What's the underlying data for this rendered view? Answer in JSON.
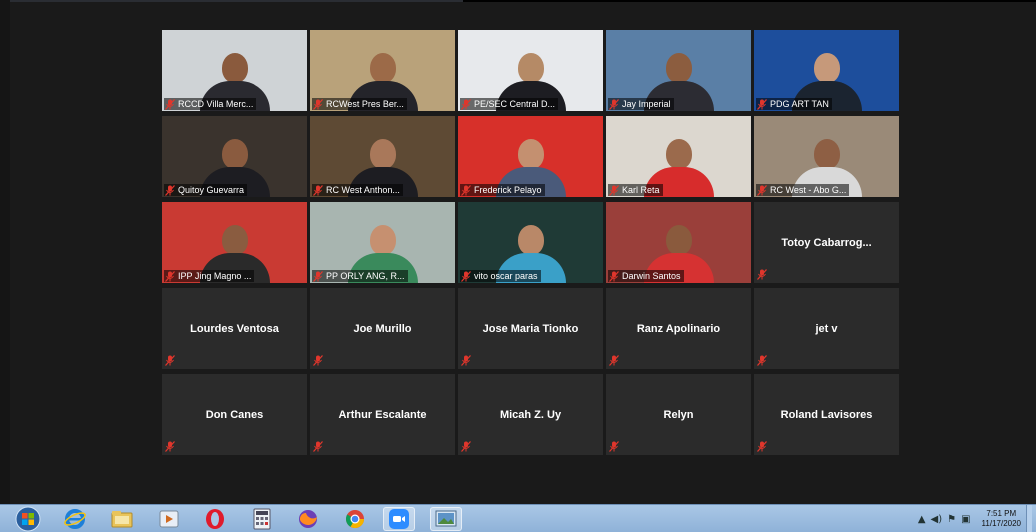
{
  "participants": [
    {
      "name": "RCCD Villa Merc...",
      "video": true,
      "bg": "#cfd3d6",
      "skin": "#8a5a3d",
      "shirt": "#2a2a30"
    },
    {
      "name": "RCWest Pres Ber...",
      "video": true,
      "bg": "#b9a27a",
      "skin": "#9c6a48",
      "shirt": "#24242a"
    },
    {
      "name": "PE/SEC Central D...",
      "video": true,
      "bg": "#e7e9ec",
      "skin": "#b58a66",
      "shirt": "#1d1d22"
    },
    {
      "name": "Jay Imperial",
      "video": true,
      "bg": "#5a7fa6",
      "skin": "#8c5d3f",
      "shirt": "#2c2c33"
    },
    {
      "name": "PDG ART TAN",
      "video": true,
      "bg": "#1d4e9c",
      "skin": "#c6997a",
      "shirt": "#1b2430"
    },
    {
      "name": "Quitoy Guevarra",
      "video": true,
      "bg": "#3a332d",
      "skin": "#8a5b3f",
      "shirt": "#1d1d22"
    },
    {
      "name": "RC West Anthon...",
      "video": true,
      "bg": "#5e4a34",
      "skin": "#a9785a",
      "shirt": "#1d1d22"
    },
    {
      "name": "Frederick Pelayo",
      "video": true,
      "bg": "#d7302a",
      "skin": "#c49070",
      "shirt": "#4a5a7a"
    },
    {
      "name": "Karl Reta",
      "video": true,
      "bg": "#dcd7cf",
      "skin": "#9b6a4c",
      "shirt": "#d72c2c"
    },
    {
      "name": "RC West - Abo G...",
      "video": true,
      "bg": "#9a8a78",
      "skin": "#8e5f44",
      "shirt": "#d9d9d9"
    },
    {
      "name": "IPP Jing Magno ...",
      "video": true,
      "bg": "#c93a33",
      "skin": "#8a5c40",
      "shirt": "#2a2a2a"
    },
    {
      "name": "PP ORLY ANG, R...",
      "video": true,
      "bg": "#a8b5b0",
      "skin": "#c69070",
      "shirt": "#3a8a5c"
    },
    {
      "name": "vito oscar paras",
      "video": true,
      "bg": "#1f3a36",
      "skin": "#b98868",
      "shirt": "#3aa0c8"
    },
    {
      "name": "Darwin Santos",
      "video": true,
      "bg": "#9a3f3a",
      "skin": "#8a5a3d",
      "shirt": "#d63232"
    },
    {
      "name": "Totoy  Cabarrog...",
      "video": false
    },
    {
      "name": "Lourdes Ventosa",
      "video": false
    },
    {
      "name": "Joe Murillo",
      "video": false
    },
    {
      "name": "Jose Maria Tionko",
      "video": false
    },
    {
      "name": "Ranz Apolinario",
      "video": false
    },
    {
      "name": "jet v",
      "video": false
    },
    {
      "name": "Don Canes",
      "video": false
    },
    {
      "name": "Arthur Escalante",
      "video": false
    },
    {
      "name": "Micah Z. Uy",
      "video": false
    },
    {
      "name": "Relyn",
      "video": false
    },
    {
      "name": "Roland Lavisores",
      "video": false
    }
  ],
  "taskbar": {
    "apps": [
      "start-orb",
      "internet-explorer",
      "file-explorer",
      "media-player",
      "opera",
      "calculator",
      "firefox",
      "chrome",
      "zoom",
      "photos"
    ],
    "clock_time": "7:51 PM",
    "clock_date": "11/17/2020"
  },
  "colors": {
    "mute_red": "#e0362c",
    "tile": "#2b2b2b",
    "meeting_bg": "#1a1a1a"
  }
}
